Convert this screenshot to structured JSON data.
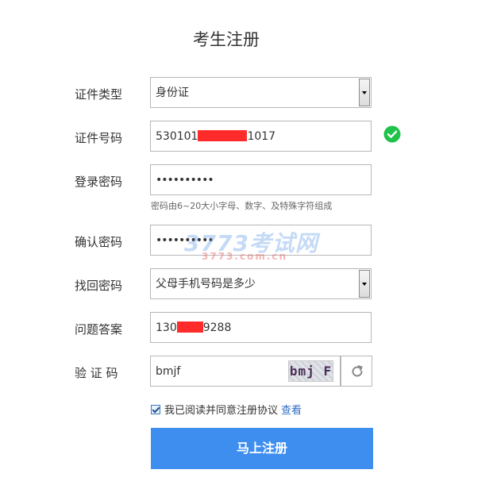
{
  "title": "考生注册",
  "form": {
    "id_type": {
      "label": "证件类型",
      "value": "身份证"
    },
    "id_number": {
      "label": "证件号码",
      "prefix": "530101",
      "suffix": "1017"
    },
    "password": {
      "label": "登录密码",
      "value": "••••••••••",
      "hint": "密码由6~20大小字母、数字、及特殊字符组成"
    },
    "confirm_password": {
      "label": "确认密码",
      "value": "••••••••••"
    },
    "recovery_question": {
      "label": "找回密码",
      "value": "父母手机号码是多少"
    },
    "answer": {
      "label": "问题答案",
      "prefix": "130",
      "suffix": "9288"
    },
    "captcha": {
      "label": "验 证 码",
      "value": "bmjf",
      "image_text": "bmj F"
    }
  },
  "agreement": {
    "text": "我已阅读并同意注册协议",
    "link": "查看",
    "checked": true
  },
  "submit_label": "马上注册",
  "watermark": {
    "main": "3773考试网",
    "sub": "3773.com.cn"
  },
  "colors": {
    "accent": "#3e8ef0",
    "valid": "#1fc24a",
    "redaction": "#ff2b2b",
    "link": "#2e6ec2"
  },
  "icons": {
    "valid": "check-circle-icon",
    "refresh": "refresh-icon",
    "dropdown": "chevron-down-icon"
  }
}
